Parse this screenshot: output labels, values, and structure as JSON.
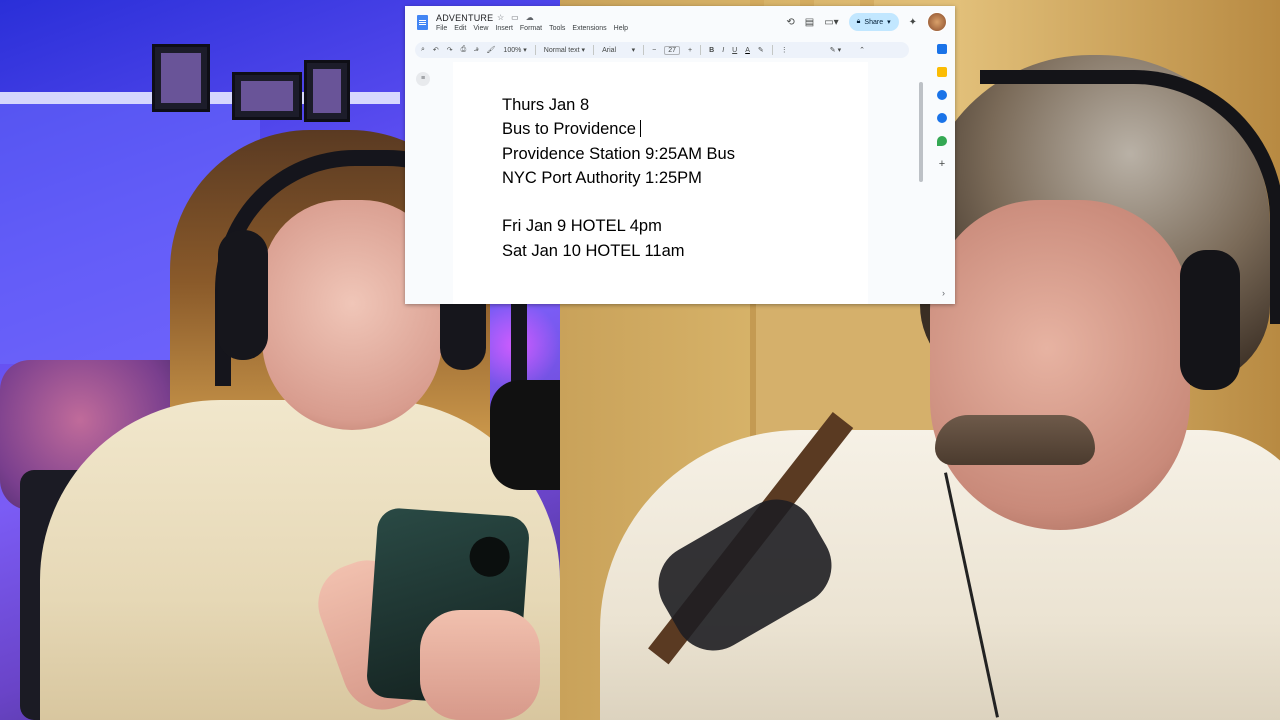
{
  "docs": {
    "title": "ADVENTURE",
    "menu": [
      "File",
      "Edit",
      "View",
      "Insert",
      "Format",
      "Tools",
      "Extensions",
      "Help"
    ],
    "share_label": "Share",
    "toolbar": {
      "zoom": "100%",
      "style": "Normal text",
      "font": "Arial",
      "font_size": "27"
    },
    "lines": [
      "Thurs Jan 8",
      "Bus to Providence",
      "Providence Station 9:25AM Bus",
      "NYC Port Authority 1:25PM",
      "",
      "Fri Jan 9 HOTEL 4pm",
      "Sat Jan 10 HOTEL 11am"
    ],
    "icons": {
      "star": "star-icon",
      "move": "folder-move-icon",
      "cloud": "cloud-saved-icon",
      "history": "history-icon",
      "comments": "comments-icon",
      "meet": "video-call-icon",
      "gemini": "gemini-icon",
      "search": "search-icon",
      "undo": "undo-icon",
      "redo": "redo-icon",
      "print": "print-icon",
      "spellcheck": "spellcheck-icon",
      "paint_format": "paint-format-icon",
      "edit_mode": "edit-mode-icon"
    },
    "side_panel_colors": [
      "#1a73e8",
      "#fbbc04",
      "#1a73e8",
      "#1a73e8",
      "#34a853"
    ]
  }
}
